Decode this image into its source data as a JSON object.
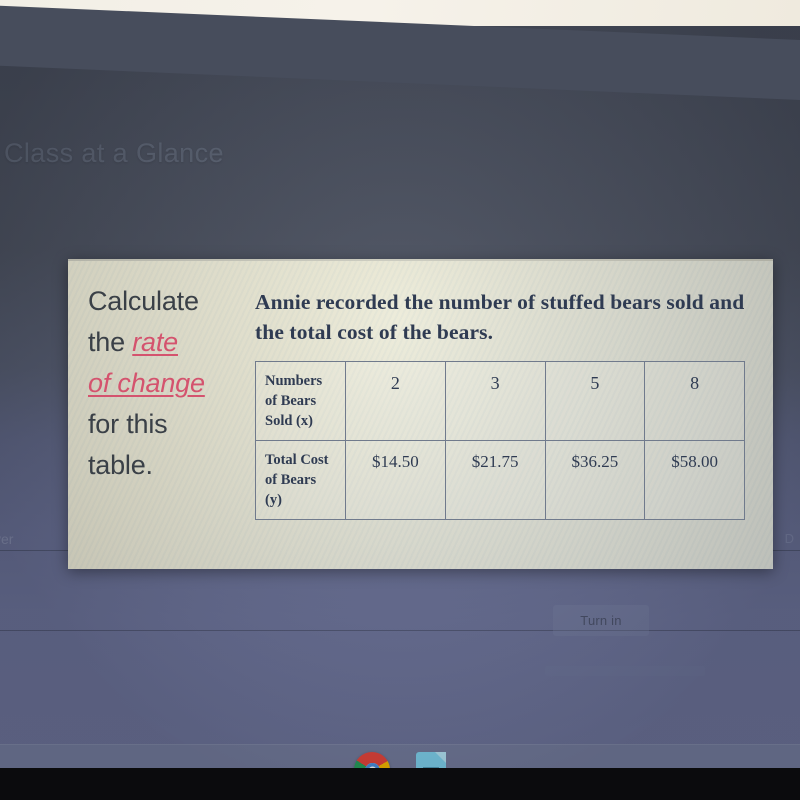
{
  "screen": {
    "background_color": "#474d5c",
    "lower_background_color": "#6d749b",
    "faint_heading": "Class at a Glance",
    "faint_left_label": "ver",
    "faint_right_label": "D"
  },
  "assignment": {
    "turn_in_label": "Turn in"
  },
  "worksheet": {
    "paper_color": "#f0eedb",
    "accent_link_color": "#d4536e",
    "prompt": {
      "line1": "Calculate",
      "line2_prefix": "the ",
      "line2_link": "rate",
      "line3_link": "of change",
      "line4": "for this",
      "line5": "table."
    },
    "question": "Annie recorded the number of stuffed bears sold and the total cost of the bears."
  },
  "chart_data": {
    "type": "table",
    "title": "Annie recorded the number of stuffed bears sold and the total cost of the bears.",
    "row_headers": [
      "Numbers of Bears Sold (x)",
      "Total Cost of Bears (y)"
    ],
    "rows": [
      {
        "header_lines": [
          "Numbers",
          "of Bears",
          "Sold (x)"
        ],
        "values": [
          "2",
          "3",
          "5",
          "8"
        ]
      },
      {
        "header_lines": [
          "Total Cost",
          "of Bears",
          "(y)"
        ],
        "values": [
          "$14.50",
          "$21.75",
          "$36.25",
          "$58.00"
        ]
      }
    ],
    "x": [
      2,
      3,
      5,
      8
    ],
    "y": [
      14.5,
      21.75,
      36.25,
      58.0
    ],
    "xlabel": "Numbers of Bears Sold (x)",
    "ylabel": "Total Cost of Bears (y)"
  },
  "taskbar": {
    "items": [
      {
        "icon": "chrome-icon",
        "label": "Google Chrome"
      },
      {
        "icon": "google-docs-icon",
        "label": "Google Docs"
      }
    ]
  }
}
